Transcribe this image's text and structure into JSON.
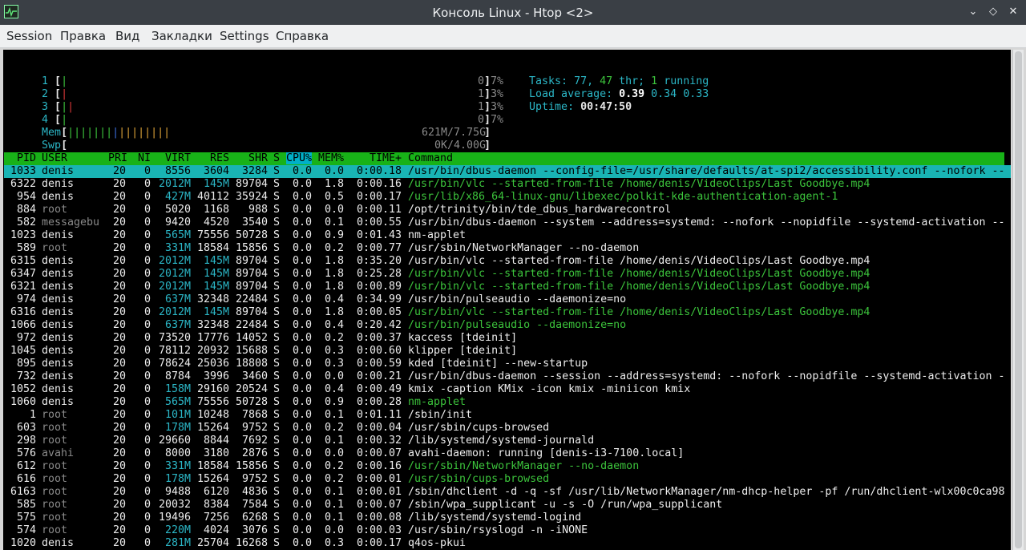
{
  "window": {
    "title": "Консоль Linux - Htop <2>"
  },
  "window_controls": {
    "minimize": "⌄",
    "maximize": "◇",
    "close": "✕"
  },
  "menubar": [
    "Session",
    "Правка",
    "Вид",
    "Закладки",
    "Settings",
    "Справка"
  ],
  "meters": {
    "cpu": [
      {
        "label": "1",
        "value": "0.7%"
      },
      {
        "label": "2",
        "value": "1.3%"
      },
      {
        "label": "3",
        "value": "1.3%"
      },
      {
        "label": "4",
        "value": "0.7%"
      }
    ],
    "mem": {
      "label": "Mem",
      "value": "621M/7.75G"
    },
    "swp": {
      "label": "Swp",
      "value": "0K/4.00G"
    }
  },
  "summary": {
    "tasks_label": "Tasks: ",
    "tasks": "77",
    "thr": "47",
    "thr_label": " thr; ",
    "running": "1",
    "running_label": " running",
    "load_label": "Load average: ",
    "load1": "0.39",
    "load5": "0.34",
    "load15": "0.33",
    "uptime_label": "Uptime: ",
    "uptime": "00:47:50"
  },
  "columns": [
    "PID",
    "USER",
    "PRI",
    "NI",
    "VIRT",
    "RES",
    "SHR",
    "S",
    "CPU%",
    "MEM%",
    "TIME+",
    "Command"
  ],
  "colors": {
    "header_bg": "#18b218",
    "selected_bg": "#19b4b4",
    "thread_green": "#3cc43c",
    "cyan": "#2bb6c6",
    "root_gray": "#8a8a8a"
  },
  "processes": [
    [
      "1033",
      "denis",
      "20",
      "0",
      "8556",
      "3604",
      "3284",
      "S",
      "0.0",
      "0.0",
      "0:00.18",
      "/usr/bin/dbus-daemon --config-file=/usr/share/defaults/at-spi2/accessibility.conf --nofork --"
    ],
    [
      "6322",
      "denis",
      "20",
      "0",
      "2012M",
      "145M",
      "89704",
      "S",
      "0.0",
      "1.8",
      "0:00.16",
      "/usr/bin/vlc --started-from-file /home/denis/VideoClips/Last Goodbye.mp4"
    ],
    [
      "954",
      "denis",
      "20",
      "0",
      "427M",
      "40112",
      "35924",
      "S",
      "0.0",
      "0.5",
      "0:00.17",
      "/usr/lib/x86_64-linux-gnu/libexec/polkit-kde-authentication-agent-1"
    ],
    [
      "884",
      "root",
      "20",
      "0",
      "5020",
      "1168",
      "988",
      "S",
      "0.0",
      "0.0",
      "0:00.11",
      "/opt/trinity/bin/tde_dbus_hardwarecontrol"
    ],
    [
      "582",
      "messagebu",
      "20",
      "0",
      "9420",
      "4520",
      "3540",
      "S",
      "0.0",
      "0.1",
      "0:00.55",
      "/usr/bin/dbus-daemon --system --address=systemd: --nofork --nopidfile --systemd-activation --"
    ],
    [
      "1023",
      "denis",
      "20",
      "0",
      "565M",
      "75556",
      "50728",
      "S",
      "0.0",
      "0.9",
      "0:01.43",
      "nm-applet"
    ],
    [
      "589",
      "root",
      "20",
      "0",
      "331M",
      "18584",
      "15856",
      "S",
      "0.0",
      "0.2",
      "0:00.77",
      "/usr/sbin/NetworkManager --no-daemon"
    ],
    [
      "6315",
      "denis",
      "20",
      "0",
      "2012M",
      "145M",
      "89704",
      "S",
      "0.0",
      "1.8",
      "0:35.20",
      "/usr/bin/vlc --started-from-file /home/denis/VideoClips/Last Goodbye.mp4"
    ],
    [
      "6347",
      "denis",
      "20",
      "0",
      "2012M",
      "145M",
      "89704",
      "S",
      "0.0",
      "1.8",
      "0:25.28",
      "/usr/bin/vlc --started-from-file /home/denis/VideoClips/Last Goodbye.mp4"
    ],
    [
      "6321",
      "denis",
      "20",
      "0",
      "2012M",
      "145M",
      "89704",
      "S",
      "0.0",
      "1.8",
      "0:00.89",
      "/usr/bin/vlc --started-from-file /home/denis/VideoClips/Last Goodbye.mp4"
    ],
    [
      "974",
      "denis",
      "20",
      "0",
      "637M",
      "32348",
      "22484",
      "S",
      "0.0",
      "0.4",
      "0:34.99",
      "/usr/bin/pulseaudio --daemonize=no"
    ],
    [
      "6316",
      "denis",
      "20",
      "0",
      "2012M",
      "145M",
      "89704",
      "S",
      "0.0",
      "1.8",
      "0:00.05",
      "/usr/bin/vlc --started-from-file /home/denis/VideoClips/Last Goodbye.mp4"
    ],
    [
      "1066",
      "denis",
      "20",
      "0",
      "637M",
      "32348",
      "22484",
      "S",
      "0.0",
      "0.4",
      "0:20.42",
      "/usr/bin/pulseaudio --daemonize=no"
    ],
    [
      "972",
      "denis",
      "20",
      "0",
      "73520",
      "17776",
      "14052",
      "S",
      "0.0",
      "0.2",
      "0:00.37",
      "kaccess [tdeinit]"
    ],
    [
      "1045",
      "denis",
      "20",
      "0",
      "78112",
      "20932",
      "15688",
      "S",
      "0.0",
      "0.3",
      "0:00.60",
      "klipper [tdeinit]"
    ],
    [
      "895",
      "denis",
      "20",
      "0",
      "78624",
      "25036",
      "18808",
      "S",
      "0.0",
      "0.3",
      "0:00.59",
      "kded [tdeinit] --new-startup"
    ],
    [
      "732",
      "denis",
      "20",
      "0",
      "8784",
      "3996",
      "3460",
      "S",
      "0.0",
      "0.0",
      "0:00.21",
      "/usr/bin/dbus-daemon --session --address=systemd: --nofork --nopidfile --systemd-activation -"
    ],
    [
      "1052",
      "denis",
      "20",
      "0",
      "158M",
      "29160",
      "20524",
      "S",
      "0.0",
      "0.4",
      "0:00.49",
      "kmix -caption KMix -icon kmix -miniicon kmix"
    ],
    [
      "1060",
      "denis",
      "20",
      "0",
      "565M",
      "75556",
      "50728",
      "S",
      "0.0",
      "0.9",
      "0:00.28",
      "nm-applet"
    ],
    [
      "1",
      "root",
      "20",
      "0",
      "101M",
      "10248",
      "7868",
      "S",
      "0.0",
      "0.1",
      "0:01.11",
      "/sbin/init"
    ],
    [
      "603",
      "root",
      "20",
      "0",
      "178M",
      "15264",
      "9752",
      "S",
      "0.0",
      "0.2",
      "0:00.04",
      "/usr/sbin/cups-browsed"
    ],
    [
      "298",
      "root",
      "20",
      "0",
      "29660",
      "8844",
      "7692",
      "S",
      "0.0",
      "0.1",
      "0:00.32",
      "/lib/systemd/systemd-journald"
    ],
    [
      "576",
      "avahi",
      "20",
      "0",
      "8000",
      "3180",
      "2876",
      "S",
      "0.0",
      "0.0",
      "0:00.07",
      "avahi-daemon: running [denis-i3-7100.local]"
    ],
    [
      "612",
      "root",
      "20",
      "0",
      "331M",
      "18584",
      "15856",
      "S",
      "0.0",
      "0.2",
      "0:00.16",
      "/usr/sbin/NetworkManager --no-daemon"
    ],
    [
      "616",
      "root",
      "20",
      "0",
      "178M",
      "15264",
      "9752",
      "S",
      "0.0",
      "0.2",
      "0:00.01",
      "/usr/sbin/cups-browsed"
    ],
    [
      "6163",
      "root",
      "20",
      "0",
      "9488",
      "6120",
      "4836",
      "S",
      "0.0",
      "0.1",
      "0:00.01",
      "/sbin/dhclient -d -q -sf /usr/lib/NetworkManager/nm-dhcp-helper -pf /run/dhclient-wlx00c0ca98"
    ],
    [
      "585",
      "root",
      "20",
      "0",
      "20032",
      "8384",
      "7584",
      "S",
      "0.0",
      "0.1",
      "0:00.07",
      "/sbin/wpa_supplicant -u -s -O /run/wpa_supplicant"
    ],
    [
      "575",
      "root",
      "20",
      "0",
      "19496",
      "7256",
      "6268",
      "S",
      "0.0",
      "0.1",
      "0:00.08",
      "/lib/systemd/systemd-logind"
    ],
    [
      "574",
      "root",
      "20",
      "0",
      "220M",
      "4024",
      "3076",
      "S",
      "0.0",
      "0.0",
      "0:00.03",
      "/usr/sbin/rsyslogd -n -iNONE"
    ],
    [
      "1020",
      "denis",
      "20",
      "0",
      "281M",
      "25704",
      "16268",
      "S",
      "0.0",
      "0.3",
      "0:00.17",
      "q4os-pkui"
    ]
  ],
  "thread_rows": [
    1,
    2,
    8,
    9,
    11,
    12,
    18,
    23,
    24
  ],
  "selected_row": 0
}
